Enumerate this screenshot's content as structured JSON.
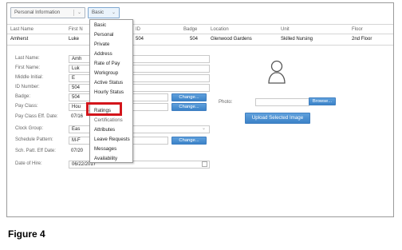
{
  "toolbar": {
    "view_select": "Personal Information",
    "subview_select": "Basic"
  },
  "grid": {
    "headers": [
      "Last Name",
      "First N",
      "ID",
      "Badge",
      "Location",
      "Unit",
      "Floor"
    ],
    "row": [
      "Amherst",
      "Luke",
      "504",
      "504",
      "Glenwood Gardens",
      "Skilled Nursing",
      "2nd Floor"
    ]
  },
  "form": {
    "labels": {
      "last_name": "Last Name:",
      "first_name": "First Name:",
      "middle_initial": "Middle Initial:",
      "id_number": "ID Number:",
      "badge": "Badge:",
      "pay_class": "Pay Class:",
      "pay_class_eff_date": "Pay Class Eff. Date:",
      "clock_group": "Clock Group:",
      "schedule_pattern": "Schedule Pattern:",
      "sch_patt_eff_date": "Sch. Patt. Eff Date:",
      "date_of_hire": "Date of Hire:",
      "photo": "Photo:"
    },
    "values": {
      "last_name": "Amh",
      "first_name": "Luk",
      "middle_initial": "E",
      "id_number": "504",
      "badge": "504",
      "pay_class": "Hou",
      "pay_class_eff_date": "07/16",
      "clock_group": "Eas",
      "schedule_pattern": "M-F",
      "sch_patt_eff_date": "07/20",
      "date_of_hire": "06/22/2017"
    },
    "buttons": {
      "change": "Change...",
      "browse": "Browse...",
      "upload": "Upload Selected Image"
    }
  },
  "dropdown": {
    "items": [
      "Basic",
      "Personal",
      "Private",
      "Address",
      "Rate of Pay",
      "Workgroup",
      "Active Status",
      "Hourly Status",
      "Ratings",
      "Certifications",
      "Attributes",
      "Leave Requests",
      "Messages",
      "Availability"
    ],
    "highlighted": "Ratings"
  },
  "caption": "Figure 4",
  "colors": {
    "highlight_border": "#d3151b",
    "button_blue": "#3b82c8"
  }
}
